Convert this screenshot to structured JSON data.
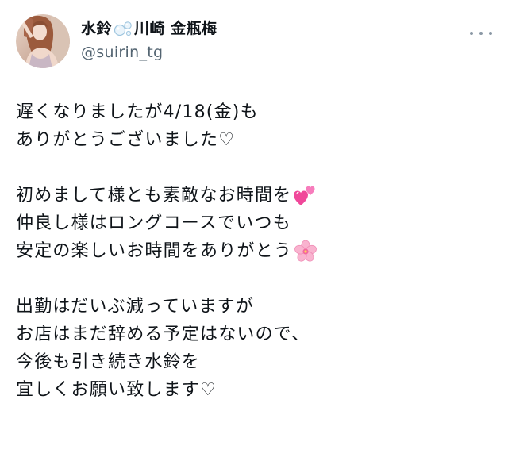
{
  "author": {
    "name_part1": "水鈴",
    "name_part2": "川崎 金瓶梅",
    "name_icon": "bubbles-icon",
    "handle": "@suirin_tg",
    "avatar_icon": "avatar-photo"
  },
  "menu": {
    "icon": "more-dots-icon"
  },
  "tweet": {
    "lines": [
      "遅くなりましたが4/18(金)も",
      "ありがとうございました♡",
      "",
      "初めまして様とも素敵なお時間を",
      "仲良し様はロングコースでいつも",
      "安定の楽しいお時間をありがとう",
      "",
      "出勤はだいぶ減っていますが",
      "お店はまだ辞める予定はないので、",
      "今後も引き続き水鈴を",
      "宜しくお願い致します♡"
    ],
    "emojis": {
      "line_4": "two-hearts-emoji-icon",
      "line_6": "cherry-blossom-emoji-icon"
    }
  },
  "colors": {
    "text": "#0f1419",
    "secondary": "#536471",
    "dots": "#8b98a5"
  }
}
